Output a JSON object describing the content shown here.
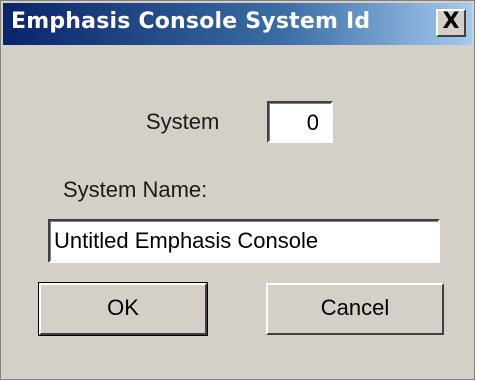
{
  "window": {
    "title": "Emphasis Console System Id",
    "close_glyph": "X",
    "close_icon": "close-icon"
  },
  "form": {
    "system_label": "System",
    "system_value": "0",
    "system_name_label": "System Name:",
    "system_name_value": "Untitled Emphasis Console"
  },
  "buttons": {
    "ok_label": "OK",
    "cancel_label": "Cancel"
  },
  "colors": {
    "title_bar_start": "#0a246a",
    "title_bar_end": "#a6caf0",
    "dialog_face": "#d4d0c8"
  }
}
